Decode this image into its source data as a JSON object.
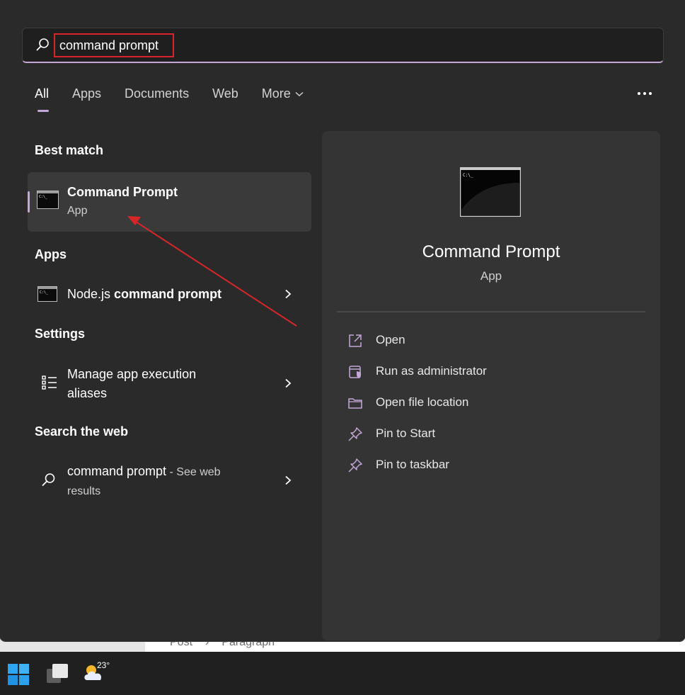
{
  "background": {
    "breadcrumb": [
      "Post",
      "Paragraph"
    ]
  },
  "search": {
    "query": "command prompt"
  },
  "tabs": [
    {
      "label": "All",
      "active": true
    },
    {
      "label": "Apps",
      "active": false
    },
    {
      "label": "Documents",
      "active": false
    },
    {
      "label": "Web",
      "active": false
    },
    {
      "label": "More",
      "active": false,
      "has_dropdown": true
    }
  ],
  "sections": {
    "best_match": "Best match",
    "apps": "Apps",
    "settings": "Settings",
    "search_the_web": "Search the web"
  },
  "best_match": {
    "title": "Command Prompt",
    "subtitle": "App",
    "icon": "command-prompt-icon"
  },
  "apps": [
    {
      "prefix": "Node.js ",
      "bold": "command prompt",
      "icon": "command-prompt-icon"
    }
  ],
  "settings": [
    {
      "line1": "Manage app execution",
      "line2": "aliases",
      "icon": "list-icon"
    }
  ],
  "web": [
    {
      "query": "command prompt",
      "suffix": " - See web",
      "line2": "results",
      "icon": "search-icon"
    }
  ],
  "preview": {
    "title": "Command Prompt",
    "subtitle": "App",
    "actions": [
      {
        "label": "Open",
        "icon": "open-external-icon"
      },
      {
        "label": "Run as administrator",
        "icon": "admin-shield-icon"
      },
      {
        "label": "Open file location",
        "icon": "folder-icon"
      },
      {
        "label": "Pin to Start",
        "icon": "pin-icon"
      },
      {
        "label": "Pin to taskbar",
        "icon": "pin-icon"
      }
    ]
  },
  "taskbar": {
    "temperature": "23°"
  },
  "colors": {
    "accent": "#c3a7d8",
    "annotation": "#d7262a",
    "panel": "#2a2a2a",
    "preview": "#343434"
  }
}
